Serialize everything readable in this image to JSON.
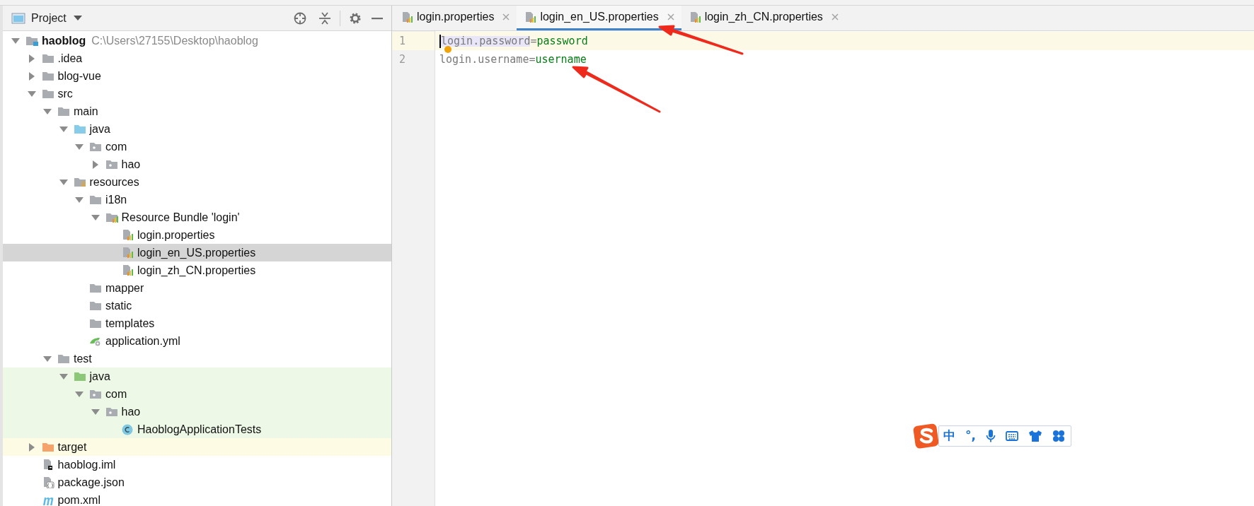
{
  "project_panel": {
    "title": "Project",
    "tree": [
      {
        "label": "haoblog",
        "path": "C:\\Users\\27155\\Desktop\\haoblog",
        "kind": "module",
        "expanded": true,
        "selected": false,
        "children": [
          {
            "label": ".idea",
            "kind": "folder",
            "expanded": false,
            "selected": false
          },
          {
            "label": "blog-vue",
            "kind": "folder",
            "expanded": false,
            "selected": false
          },
          {
            "label": "src",
            "kind": "folder",
            "expanded": true,
            "selected": false,
            "children": [
              {
                "label": "main",
                "kind": "folder",
                "expanded": true,
                "selected": false,
                "children": [
                  {
                    "label": "java",
                    "kind": "source",
                    "expanded": true,
                    "selected": false,
                    "children": [
                      {
                        "label": "com",
                        "kind": "package",
                        "expanded": true,
                        "selected": false,
                        "children": [
                          {
                            "label": "hao",
                            "kind": "package",
                            "expanded": false,
                            "selected": false
                          }
                        ]
                      }
                    ]
                  },
                  {
                    "label": "resources",
                    "kind": "resources",
                    "expanded": true,
                    "selected": false,
                    "children": [
                      {
                        "label": "i18n",
                        "kind": "folder",
                        "expanded": true,
                        "selected": false,
                        "children": [
                          {
                            "label": "Resource Bundle 'login'",
                            "kind": "bundle",
                            "expanded": true,
                            "selected": false,
                            "children": [
                              {
                                "label": "login.properties",
                                "kind": "properties",
                                "selected": false
                              },
                              {
                                "label": "login_en_US.properties",
                                "kind": "properties",
                                "selected": true
                              },
                              {
                                "label": "login_zh_CN.properties",
                                "kind": "properties",
                                "selected": false
                              }
                            ]
                          }
                        ]
                      },
                      {
                        "label": "mapper",
                        "kind": "empty-folder",
                        "selected": false
                      },
                      {
                        "label": "static",
                        "kind": "empty-folder",
                        "selected": false
                      },
                      {
                        "label": "templates",
                        "kind": "empty-folder",
                        "selected": false
                      },
                      {
                        "label": "application.yml",
                        "kind": "yml",
                        "selected": false
                      }
                    ]
                  }
                ]
              },
              {
                "label": "test",
                "kind": "folder",
                "expanded": true,
                "selected": false,
                "children": [
                  {
                    "label": "java",
                    "kind": "test-source",
                    "expanded": true,
                    "selected": false,
                    "children": [
                      {
                        "label": "com",
                        "kind": "package",
                        "expanded": true,
                        "selected": false,
                        "children": [
                          {
                            "label": "hao",
                            "kind": "package",
                            "expanded": true,
                            "selected": false,
                            "children": [
                              {
                                "label": "HaoblogApplicationTests",
                                "kind": "class",
                                "selected": false
                              }
                            ]
                          }
                        ]
                      }
                    ]
                  }
                ]
              }
            ]
          },
          {
            "label": "target",
            "kind": "excluded",
            "expanded": false,
            "selected": false
          },
          {
            "label": "haoblog.iml",
            "kind": "iml",
            "selected": false
          },
          {
            "label": "package.json",
            "kind": "json",
            "selected": false
          },
          {
            "label": "pom.xml",
            "kind": "maven",
            "selected": false
          }
        ]
      }
    ]
  },
  "editor": {
    "tabs": [
      {
        "label": "login.properties",
        "selected": false
      },
      {
        "label": "login_en_US.properties",
        "selected": true
      },
      {
        "label": "login_zh_CN.properties",
        "selected": false
      }
    ],
    "lines": [
      {
        "number": "1",
        "key": "login.password",
        "separator": "=",
        "value": "password",
        "current": true
      },
      {
        "number": "2",
        "key": "login.username",
        "separator": "=",
        "value": "username",
        "current": false
      }
    ]
  },
  "input_method_toolbar": {
    "items": [
      "中",
      "°,"
    ]
  }
}
